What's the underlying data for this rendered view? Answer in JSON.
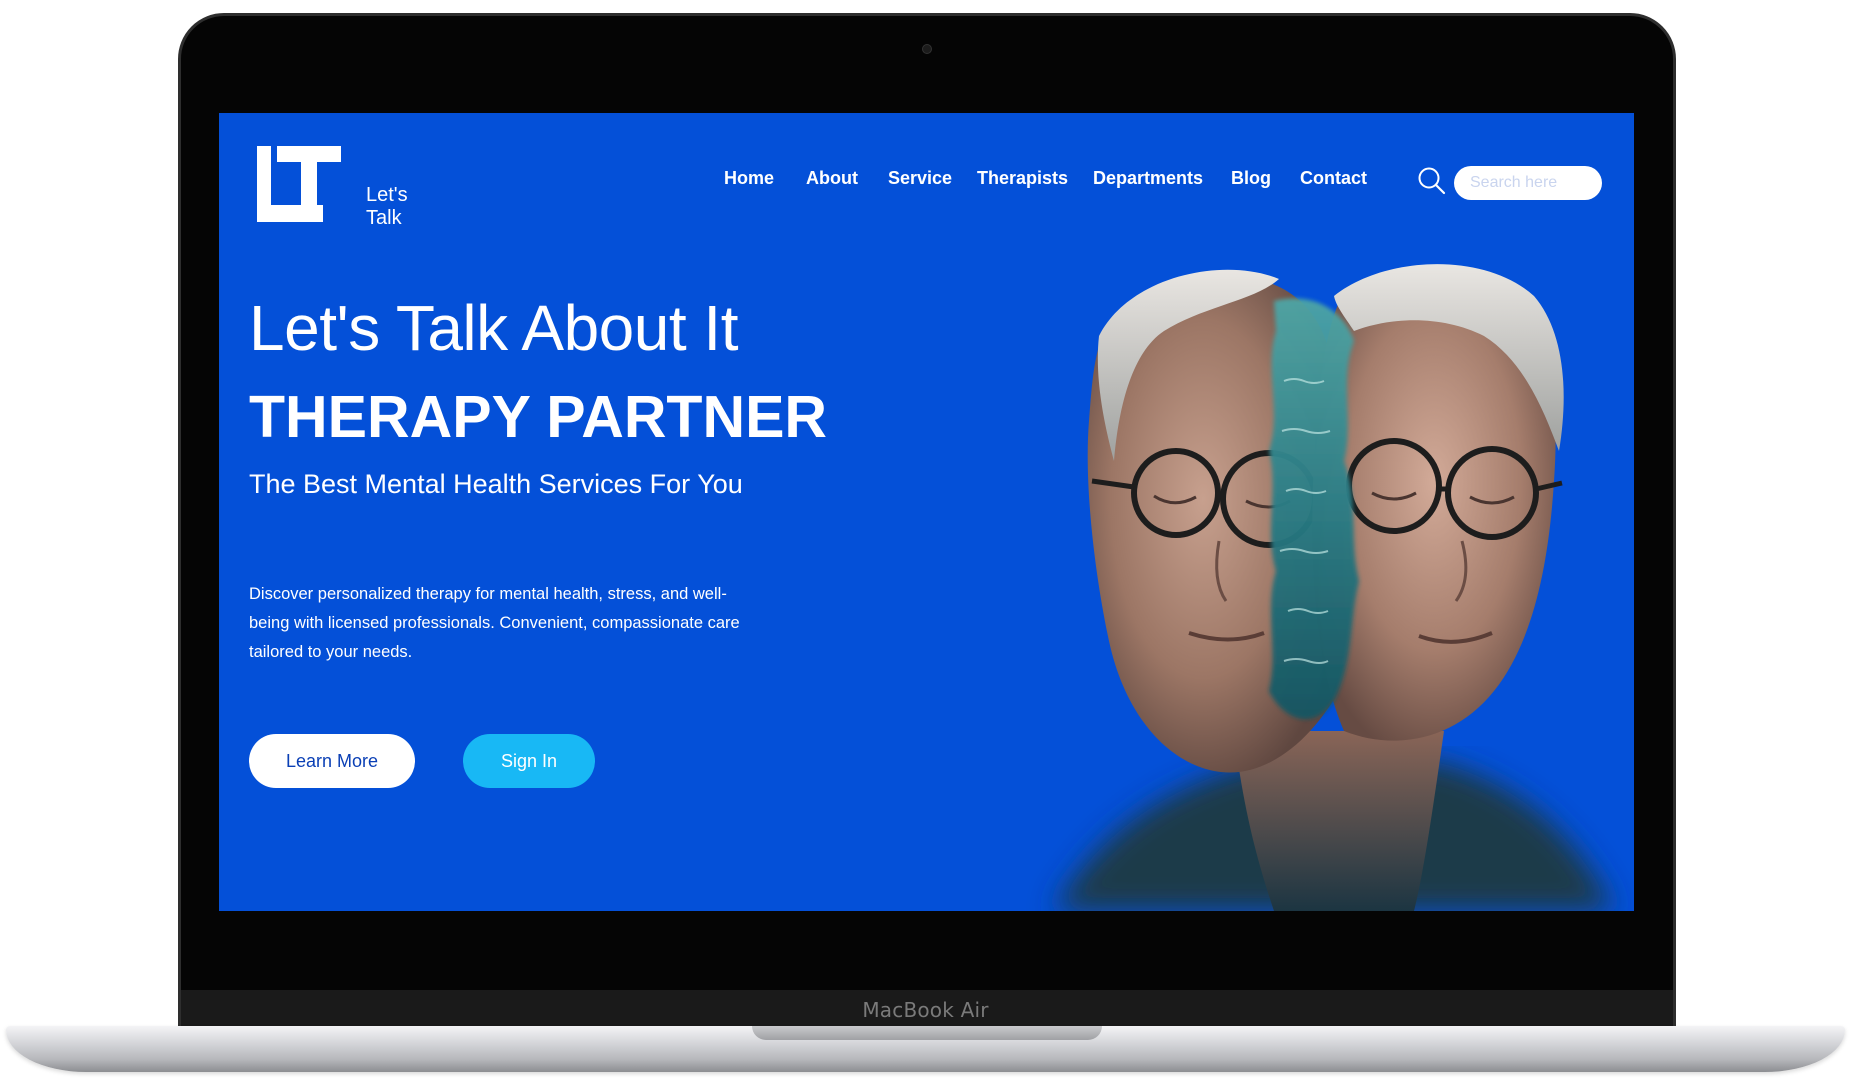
{
  "device": {
    "brand_label": "MacBook Air"
  },
  "site": {
    "logo_mark": "LT",
    "logo_text": "Let's Talk"
  },
  "nav": {
    "items": [
      {
        "label": "Home"
      },
      {
        "label": "About"
      },
      {
        "label": "Service"
      },
      {
        "label": "Therapists"
      },
      {
        "label": "Departments"
      },
      {
        "label": "Blog"
      },
      {
        "label": "Contact"
      }
    ]
  },
  "search": {
    "placeholder": "Search here",
    "value": "",
    "icon": "search-icon"
  },
  "hero": {
    "heading": "Let's Talk About It",
    "tagline": "THERAPY PARTNER",
    "subheading": "The Best Mental Health Services For You",
    "description": "Discover personalized therapy for mental health, stress, and well-being with licensed professionals. Convenient, compassionate care tailored to your needs.",
    "learn_more_label": "Learn More",
    "sign_in_label": "Sign In",
    "image": "two-elderly-women-faces-with-water-double-exposure"
  },
  "colors": {
    "screen_background": "#0450d8",
    "primary_button_bg": "#ffffff",
    "primary_button_text": "#0a3fb5",
    "secondary_button_bg": "#18b8f5",
    "text": "#ffffff"
  }
}
